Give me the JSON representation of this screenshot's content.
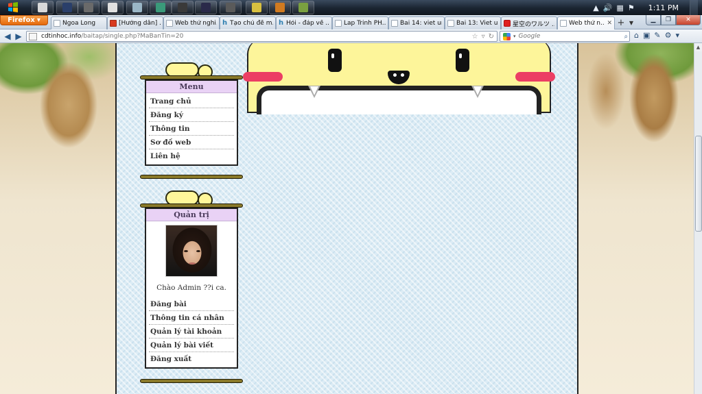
{
  "taskbar": {
    "clock": "1:11 PM",
    "pinned": [
      {
        "name": "explorer",
        "color": "#d9d9d9"
      },
      {
        "name": "photoshop",
        "color": "#2a3f6a"
      },
      {
        "name": "media-player",
        "color": "#6a6a6a"
      },
      {
        "name": "app-4",
        "color": "#e0e0e0"
      },
      {
        "name": "app-5",
        "color": "#9ab6c6"
      },
      {
        "name": "app-6",
        "color": "#3a9a7a"
      },
      {
        "name": "dreamweaver",
        "color": "#3a3a3a"
      },
      {
        "name": "after-effects",
        "color": "#2a2a4a"
      },
      {
        "name": "app-9",
        "color": "#5a5a5a"
      },
      {
        "name": "notepad",
        "color": "#d8c040"
      },
      {
        "name": "app-11",
        "color": "#d07a20"
      },
      {
        "name": "app-12",
        "color": "#7aa040"
      }
    ]
  },
  "browser": {
    "menu_label": "Firefox",
    "tabs": [
      {
        "title": "Ngoa Long",
        "fav": "blank",
        "active": false
      },
      {
        "title": "[Hướng dẫn] ...",
        "fav": "red",
        "active": false
      },
      {
        "title": "Web thử nghi...",
        "fav": "blank",
        "active": false
      },
      {
        "title": "Tạo chủ đề m...",
        "fav": "h",
        "active": false
      },
      {
        "title": "Hỏi - đáp về ...",
        "fav": "h",
        "active": false
      },
      {
        "title": "Lap Trinh PH...",
        "fav": "blank",
        "active": false
      },
      {
        "title": "Bai 14: viet un...",
        "fav": "blank",
        "active": false
      },
      {
        "title": "Bai 13: Viet u...",
        "fav": "blank",
        "active": false
      },
      {
        "title": "星空のワルツ ...",
        "fav": "yt",
        "active": false
      },
      {
        "title": "Web thử n...",
        "fav": "blank",
        "active": true
      }
    ],
    "url_host": "cdtinhoc.info",
    "url_path": "/baitap/single.php?MaBanTin=20",
    "search_placeholder": "Google"
  },
  "menu_box": {
    "heading": "Menu",
    "items": [
      "Trang chủ",
      "Đăng ký",
      "Thông tin",
      "Sơ đồ web",
      "Liên hệ"
    ]
  },
  "admin_box": {
    "heading": "Quản trị",
    "greeting": "Chào Admin ??i ca.",
    "items": [
      "Đăng bài",
      "Thông tin cá nhân",
      "Quản lý tài khoản",
      "Quản lý bài viết",
      "Đăng xuất"
    ]
  },
  "colors": {
    "mascot_face": "#fdf59a",
    "cheek": "#ec3e64",
    "box_heading": "#e9d2f5",
    "page_bg": "#dcecf5"
  }
}
